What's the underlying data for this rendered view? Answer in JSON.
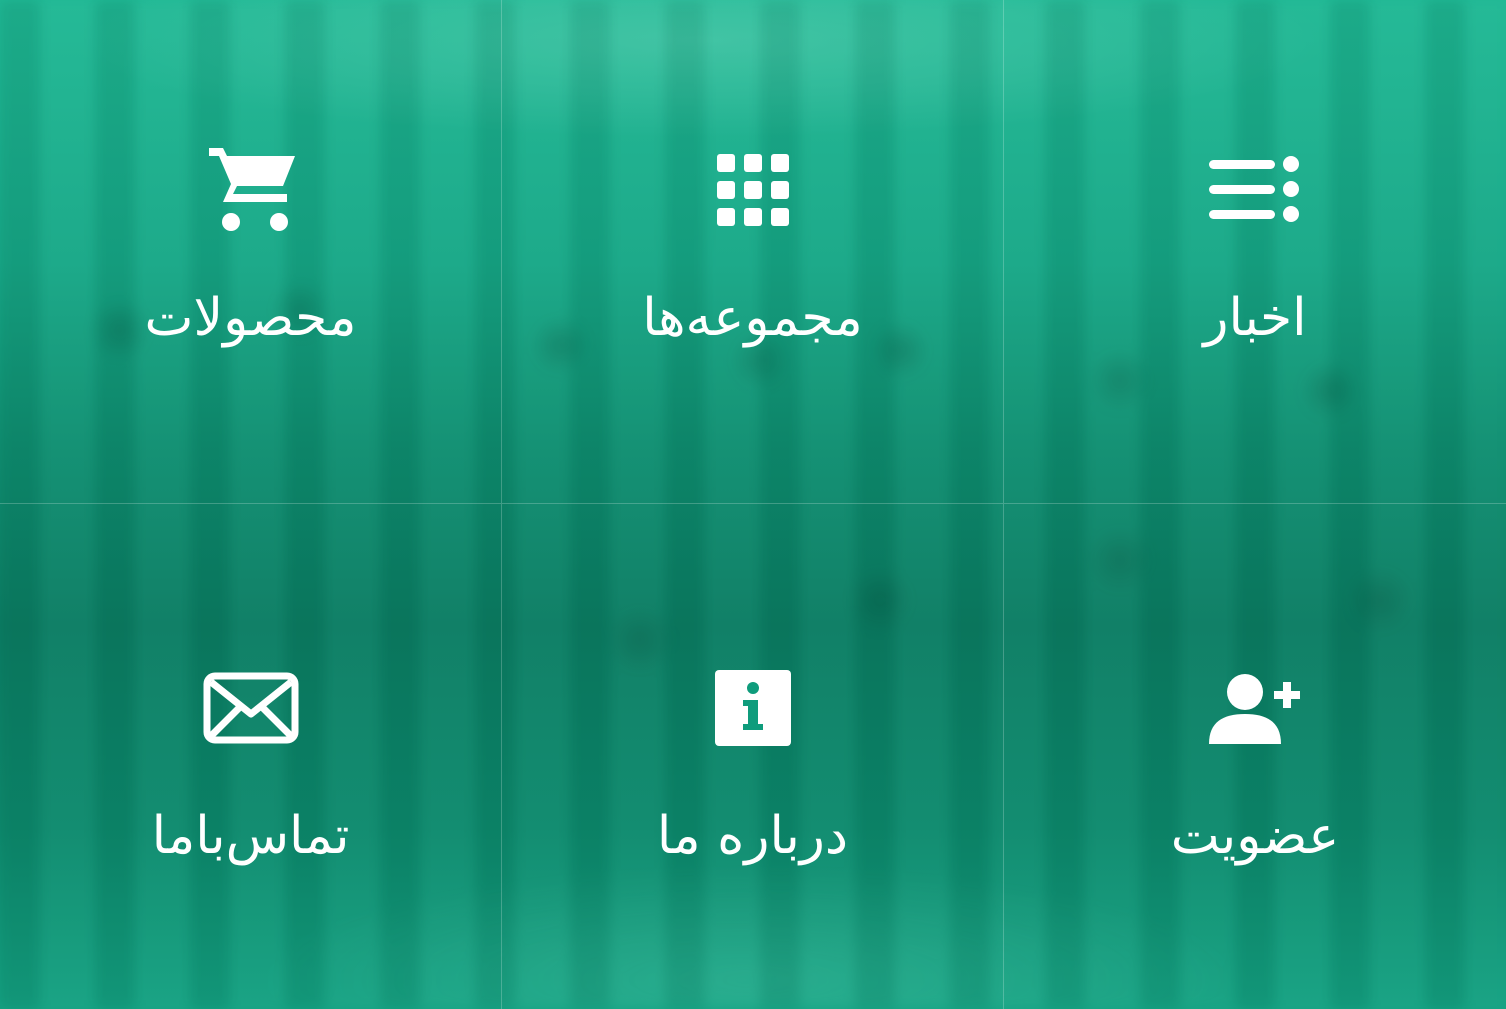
{
  "menu": {
    "items": [
      {
        "label": "محصولات",
        "icon": "cart-icon"
      },
      {
        "label": "مجموعه‌ها",
        "icon": "grid-icon"
      },
      {
        "label": "اخبار",
        "icon": "news-list-icon"
      },
      {
        "label": "تماس‌باما",
        "icon": "mail-icon"
      },
      {
        "label": "درباره ما",
        "icon": "info-icon"
      },
      {
        "label": "عضویت",
        "icon": "add-user-icon"
      }
    ]
  },
  "colors": {
    "overlay": "#0f9c7c",
    "text": "#ffffff"
  }
}
